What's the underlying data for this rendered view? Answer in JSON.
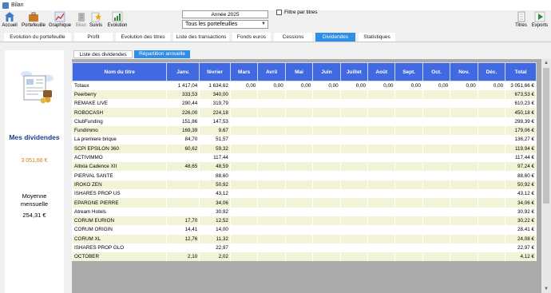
{
  "window": {
    "title": "Bilan"
  },
  "toolbar": {
    "accueil": "Accueil",
    "portefeuille": "Portefeuille",
    "graphique": "Graphique",
    "bilan": "Bilan",
    "suivis": "Suivis",
    "evolution": "Evolution",
    "titres": "Titres",
    "exports": "Exports"
  },
  "filters": {
    "year": "Année 2025",
    "portfolio": "Tous les portefeuilles",
    "filter_label": "Filtre par titres"
  },
  "nav_tabs": [
    "Evolution du portefeuille",
    "Profit",
    "Evolution des titres",
    "Liste des transactions",
    "Fonds euros",
    "Cessions",
    "Dividendes",
    "Statistiques"
  ],
  "left_panel": {
    "title": "Mes dividendes",
    "total": "3 051,66 €",
    "average_label_line1": "Moyenne",
    "average_label_line2": "mensuelle",
    "average_value": "254,31 €"
  },
  "sub_tabs": [
    "Liste des dividendes",
    "Répartition annuelle"
  ],
  "table": {
    "columns": [
      "Nom du titre",
      "Janv.",
      "février",
      "Mars",
      "Avril",
      "Mai",
      "Juin",
      "Juillet",
      "Août",
      "Sept.",
      "Oct.",
      "Nov.",
      "Déc.",
      "Total"
    ],
    "rows": [
      [
        "Totaux",
        "1 417,04",
        "1 634,62",
        "0,00",
        "0,00",
        "0,00",
        "0,00",
        "0,00",
        "0,00",
        "0,00",
        "0,00",
        "0,00",
        "0,00",
        "3 051,66 €"
      ],
      [
        "Peerberry",
        "333,53",
        "340,00",
        "",
        "",
        "",
        "",
        "",
        "",
        "",
        "",
        "",
        "",
        "673,53 €"
      ],
      [
        "REMAKE LIVE",
        "290,44",
        "319,79",
        "",
        "",
        "",
        "",
        "",
        "",
        "",
        "",
        "",
        "",
        "610,23 €"
      ],
      [
        "ROBOCASH",
        "226,00",
        "224,18",
        "",
        "",
        "",
        "",
        "",
        "",
        "",
        "",
        "",
        "",
        "450,18 €"
      ],
      [
        "ClubFunding",
        "151,86",
        "147,53",
        "",
        "",
        "",
        "",
        "",
        "",
        "",
        "",
        "",
        "",
        "299,39 €"
      ],
      [
        "Fundimmo",
        "169,39",
        "9,67",
        "",
        "",
        "",
        "",
        "",
        "",
        "",
        "",
        "",
        "",
        "179,06 €"
      ],
      [
        "La premiere brique",
        "84,70",
        "51,57",
        "",
        "",
        "",
        "",
        "",
        "",
        "",
        "",
        "",
        "",
        "136,27 €"
      ],
      [
        "SCPI EPSILON 360",
        "60,62",
        "59,32",
        "",
        "",
        "",
        "",
        "",
        "",
        "",
        "",
        "",
        "",
        "119,94 €"
      ],
      [
        "ACTIVIMMO",
        "",
        "117,44",
        "",
        "",
        "",
        "",
        "",
        "",
        "",
        "",
        "",
        "",
        "117,44 €"
      ],
      [
        "Altixia Cadence XII",
        "48,65",
        "48,59",
        "",
        "",
        "",
        "",
        "",
        "",
        "",
        "",
        "",
        "",
        "97,24 €"
      ],
      [
        "PIERVAL SANTE",
        "",
        "88,60",
        "",
        "",
        "",
        "",
        "",
        "",
        "",
        "",
        "",
        "",
        "88,60 €"
      ],
      [
        "IROKO ZEN",
        "",
        "50,92",
        "",
        "",
        "",
        "",
        "",
        "",
        "",
        "",
        "",
        "",
        "50,92 €"
      ],
      [
        "ISHARES PROP US",
        "",
        "43,12",
        "",
        "",
        "",
        "",
        "",
        "",
        "",
        "",
        "",
        "",
        "43,12 €"
      ],
      [
        "EPARGNE PIERRE",
        "",
        "34,06",
        "",
        "",
        "",
        "",
        "",
        "",
        "",
        "",
        "",
        "",
        "34,06 €"
      ],
      [
        "Atream Hotels",
        "",
        "30,92",
        "",
        "",
        "",
        "",
        "",
        "",
        "",
        "",
        "",
        "",
        "30,92 €"
      ],
      [
        "CORUM EURION",
        "17,70",
        "12,52",
        "",
        "",
        "",
        "",
        "",
        "",
        "",
        "",
        "",
        "",
        "30,22 €"
      ],
      [
        "CORUM ORIGIN",
        "14,41",
        "14,00",
        "",
        "",
        "",
        "",
        "",
        "",
        "",
        "",
        "",
        "",
        "28,41 €"
      ],
      [
        "CORUM XL",
        "12,76",
        "11,32",
        "",
        "",
        "",
        "",
        "",
        "",
        "",
        "",
        "",
        "",
        "24,08 €"
      ],
      [
        "ISHARES PROP GLO",
        "",
        "22,97",
        "",
        "",
        "",
        "",
        "",
        "",
        "",
        "",
        "",
        "",
        "22,97 €"
      ],
      [
        "OCTOBER",
        "2,10",
        "2,02",
        "",
        "",
        "",
        "",
        "",
        "",
        "",
        "",
        "",
        "",
        "4,12 €"
      ]
    ]
  },
  "colors": {
    "accent_blue": "#2f8ee6",
    "header_blue": "#4169e1",
    "title_blue": "#1a3e96",
    "total_orange": "#d07c12",
    "row_alt": "#f3f3d7"
  },
  "icons": {
    "accueil": "house-icon",
    "portefeuille": "briefcase-icon",
    "graphique": "chart-icon",
    "bilan": "balance-icon",
    "suivis": "star-icon",
    "evolution": "growth-icon",
    "titres": "document-icon",
    "exports": "arrow-export-icon"
  }
}
